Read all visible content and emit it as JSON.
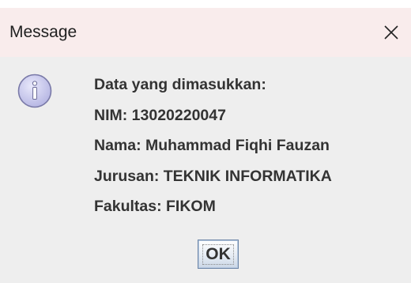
{
  "window": {
    "title": "Message",
    "close_icon": "close-icon"
  },
  "message": {
    "icon": "info-icon",
    "lines": [
      "Data yang dimasukkan:",
      "NIM: 13020220047",
      "Nama: Muhammad Fiqhi Fauzan",
      "Jurusan: TEKNIK INFORMATIKA",
      "Fakultas: FIKOM"
    ]
  },
  "buttons": {
    "ok_label": "OK"
  },
  "colors": {
    "titlebar": "#f9ecec",
    "body": "#eeeeee",
    "text": "#333333",
    "icon_fill": "#c9c9ee"
  }
}
